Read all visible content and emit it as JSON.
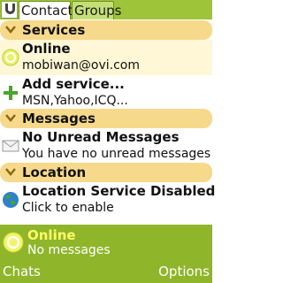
{
  "tabs": [
    {
      "label": "Contacts"
    },
    {
      "label": "Groups"
    }
  ],
  "sections": [
    {
      "title": "Services"
    },
    {
      "title": "Messages"
    },
    {
      "title": "Location"
    }
  ],
  "rows": [
    {
      "title": "Online",
      "subtitle": "mobiwan@ovi.com",
      "icon": "online-status-icon"
    },
    {
      "title": "Add service...",
      "subtitle": "MSN,Yahoo,ICQ...",
      "icon": "add-icon"
    },
    {
      "title": "No Unread Messages",
      "subtitle": "You have no unread messages",
      "icon": "envelope-icon"
    },
    {
      "title": "Location Service Disabled",
      "subtitle": "Click to enable",
      "icon": "globe-icon"
    }
  ],
  "status": {
    "title": "Online",
    "subtitle": "No messages"
  },
  "softkeys": {
    "left": "Chats",
    "right": "Options"
  },
  "colors": {
    "tabbar": "#9ec53a",
    "section_header": "#f7d98c",
    "status_bar": "#8fb52a",
    "status_title": "#ffff66"
  }
}
